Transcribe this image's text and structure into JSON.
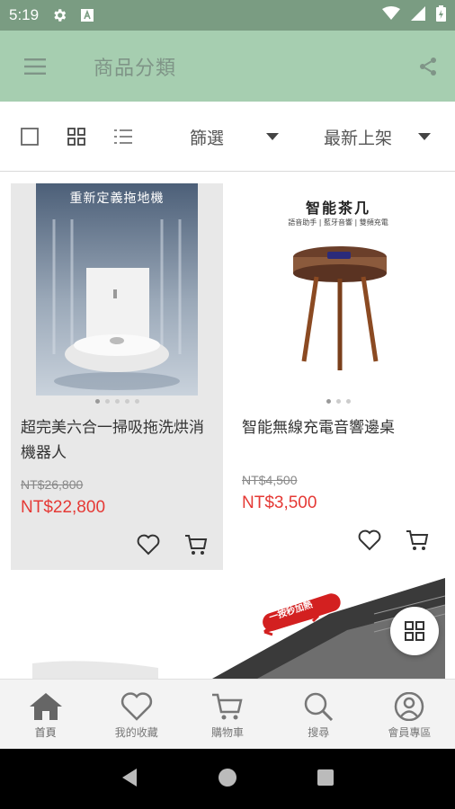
{
  "status_bar": {
    "time": "5:19"
  },
  "app_bar": {
    "title": "商品分類"
  },
  "toolbar": {
    "filter_label": "篩選",
    "sort_label": "最新上架"
  },
  "products": [
    {
      "image_caption": "重新定義拖地機",
      "name": "超完美六合一掃吸拖洗烘消機器人",
      "old_price": "NT$26,800",
      "price": "NT$22,800"
    },
    {
      "image_caption": "智能茶几",
      "image_subcaption": "語音助手 | 藍牙音響 | 雙頻充電",
      "name": "智能無線充電音響邊桌",
      "old_price": "NT$4,500",
      "price": "NT$3,500"
    }
  ],
  "banner": {
    "tag": "一按秒加熱"
  },
  "bottom_nav": [
    {
      "label": "首頁",
      "icon": "home-icon"
    },
    {
      "label": "我的收藏",
      "icon": "heart-icon"
    },
    {
      "label": "購物車",
      "icon": "cart-icon"
    },
    {
      "label": "搜尋",
      "icon": "search-icon"
    },
    {
      "label": "會員專區",
      "icon": "user-icon"
    }
  ],
  "colors": {
    "status_bar": "#7a9c82",
    "app_bar": "#a6ceb0",
    "price": "#e53935"
  }
}
